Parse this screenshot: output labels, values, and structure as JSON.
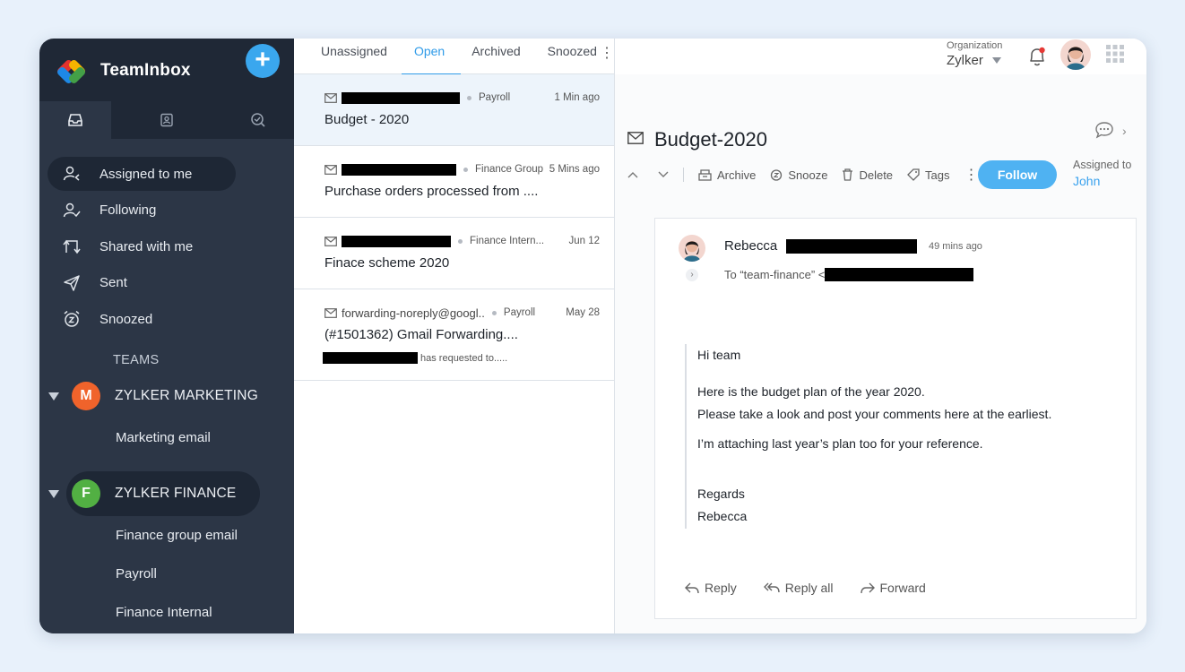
{
  "app": {
    "name": "TeamInbox",
    "add_label": "+"
  },
  "sidebar": {
    "nav": [
      {
        "label": "Assigned to me",
        "icon": "assigned-user-icon"
      },
      {
        "label": "Following",
        "icon": "following-user-icon"
      },
      {
        "label": "Shared with me",
        "icon": "shared-arrows-icon"
      },
      {
        "label": "Sent",
        "icon": "paper-plane-icon"
      },
      {
        "label": "Snoozed",
        "icon": "snooze-clock-icon"
      }
    ],
    "teams_heading": "TEAMS",
    "teams": [
      {
        "initial": "M",
        "name": "ZYLKER MARKETING",
        "color": "#f0632b",
        "subs": [
          "Marketing email"
        ]
      },
      {
        "initial": "F",
        "name": "ZYLKER FINANCE",
        "color": "#52b043",
        "subs": [
          "Finance group email",
          "Payroll",
          "Finance Internal"
        ]
      }
    ]
  },
  "list": {
    "tabs": [
      "Unassigned",
      "Open",
      "Archived",
      "Snoozed"
    ],
    "active_tab": "Open",
    "mails": [
      {
        "group": "Payroll",
        "time": "1 Min ago",
        "subject": "Budget - 2020",
        "snippet": ""
      },
      {
        "group": "Finance Group",
        "time": "5 Mins ago",
        "subject": "Purchase orders processed from ....",
        "snippet": ""
      },
      {
        "group": "Finance Intern...",
        "time": "Jun 12",
        "subject": "Finace scheme 2020",
        "snippet": ""
      },
      {
        "from": "forwarding-noreply@googl..",
        "group": "Payroll",
        "time": "May 28",
        "subject": "(#1501362) Gmail Forwarding....",
        "snippet": "has requested to....."
      }
    ]
  },
  "header": {
    "org_label": "Organization",
    "org_value": "Zylker"
  },
  "detail": {
    "title": "Budget-2020",
    "actions": [
      "Archive",
      "Snooze",
      "Delete",
      "Tags"
    ],
    "follow_label": "Follow",
    "assigned_label": "Assigned to",
    "assigned_to": "John",
    "sender_name": "Rebecca",
    "time_ago": "49 mins ago",
    "to_prefix": "To “team-finance” <",
    "body": {
      "greeting": "Hi team",
      "line1": "Here is the budget plan of the year 2020.",
      "line2": "Please take a look and post your comments here at the earliest.",
      "line3": "I’m attaching last year’s plan too for your reference.",
      "sign1": "Regards",
      "sign2": "Rebecca"
    },
    "reply": "Reply",
    "reply_all": "Reply all",
    "forward": "Forward"
  },
  "colors": {
    "accent": "#2f9be8",
    "sidebar": "#1f2836",
    "follow": "#4fb2f2"
  }
}
